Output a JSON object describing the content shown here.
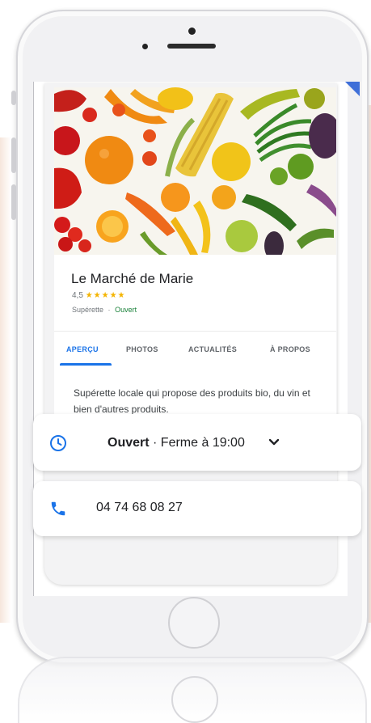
{
  "place": {
    "name": "Le Marché de Marie",
    "rating": "4,5",
    "stars": "★★★★★",
    "category": "Supérette",
    "separator": "·",
    "status": "Ouvert"
  },
  "tabs": [
    {
      "label": "APERÇU",
      "active": true
    },
    {
      "label": "PHOTOS",
      "active": false
    },
    {
      "label": "ACTUALITÉS",
      "active": false
    },
    {
      "label": "À PROPOS",
      "active": false
    }
  ],
  "description": "Supérette locale qui propose des produits bio, du vin et bien d'autres produits.",
  "hours": {
    "status": "Ouvert",
    "detail": " · Ferme à 19:00",
    "icon": "clock-icon",
    "expand_icon": "chevron-down-icon"
  },
  "contact": {
    "phone": "04 74 68 08 27",
    "icon": "phone-icon"
  },
  "colors": {
    "accent": "#1a73e8",
    "open": "#188038",
    "stars": "#f4b400"
  }
}
